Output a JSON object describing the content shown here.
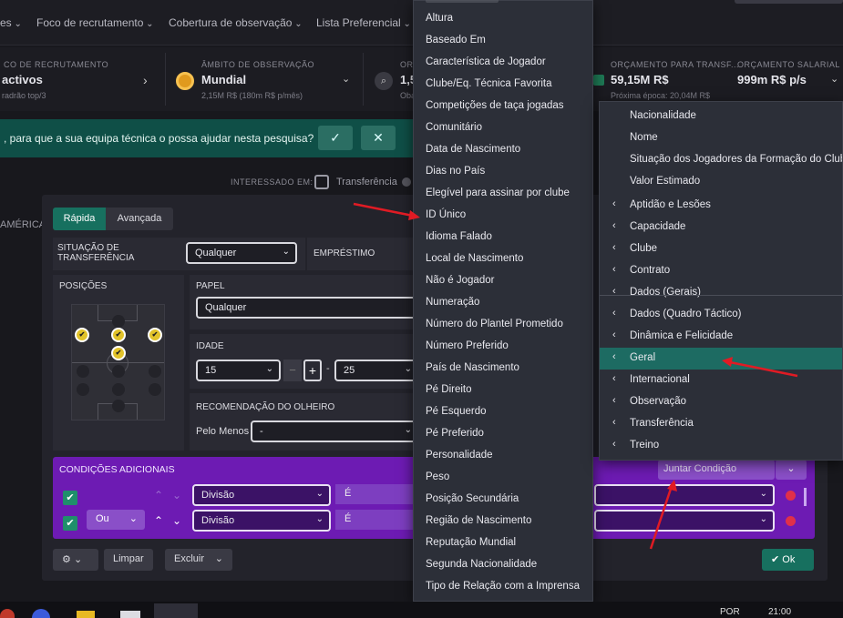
{
  "nav": {
    "items": [
      "es",
      "Foco de recrutamento",
      "Cobertura de observação",
      "Lista Preferencial"
    ]
  },
  "stats": {
    "focus": {
      "label": "CO DE RECRUTAMENTO",
      "value": "activos",
      "sub": "radrão top/3"
    },
    "scope": {
      "label": "ÂMBITO DE OBSERVAÇÃO",
      "value": "Mundial",
      "sub": "2,15M R$ (180m R$ p/mês)"
    },
    "third": {
      "label": "OR",
      "value": "1,5",
      "sub": "Oba"
    },
    "transfer_budget": {
      "label": "ORÇAMENTO PARA TRANSF...",
      "value": "59,15M R$",
      "sub": "Próxima época: 20,04M R$"
    },
    "wage_budget": {
      "label": "ORÇAMENTO SALARIAL",
      "value": "999m R$ p/s"
    }
  },
  "banner": {
    "text": ", para que a sua equipa técnica o possa ajudar nesta pesquisa?",
    "confirm": "✓",
    "dismiss": "✕"
  },
  "interest": {
    "label": "INTERESSADO EM:",
    "option": "Transferência"
  },
  "left_edge_text": "AMÉRICA",
  "dialog": {
    "tabs": [
      "Rápida",
      "Avançada"
    ],
    "transfer_status": {
      "label": "SITUAÇÃO DE TRANSFERÊNCIA",
      "value": "Qualquer"
    },
    "loan": {
      "label": "EMPRÉSTIMO"
    },
    "positions": {
      "label": "POSIÇÕES"
    },
    "role": {
      "label": "PAPEL",
      "value": "Qualquer"
    },
    "age": {
      "label": "IDADE",
      "min": "15",
      "max": "25",
      "minus": "−",
      "plus": "+",
      "dash": "-"
    },
    "scout": {
      "label": "RECOMENDAÇÃO DO OLHEIRO",
      "prefix": "Pelo Menos",
      "value": "-"
    },
    "conditions": {
      "label": "CONDIÇÕES ADICIONAIS",
      "join": "Juntar Condição",
      "rows": [
        {
          "connector": "",
          "field": "Divisão",
          "op": "É"
        },
        {
          "connector": "Ou",
          "field": "Divisão",
          "op": "É"
        }
      ]
    },
    "footer": {
      "clear": "Limpar",
      "delete": "Excluir",
      "ok": "Ok"
    }
  },
  "dropdown_main": {
    "items": [
      "Altura",
      "Baseado Em",
      "Característica de Jogador",
      "Clube/Eq. Técnica Favorita",
      "Competições de taça jogadas",
      "Comunitário",
      "Data de Nascimento",
      "Dias no País",
      "Elegível para assinar por clube",
      "ID Único",
      "Idioma Falado",
      "Local de Nascimento",
      "Não é Jogador",
      "Numeração",
      "Número do Plantel Prometido",
      "Número Preferido",
      "País de Nascimento",
      "Pé Direito",
      "Pé Esquerdo",
      "Pé Preferido",
      "Personalidade",
      "Peso",
      "Posição Secundária",
      "Região de Nascimento",
      "Reputação Mundial",
      "Segunda Nacionalidade",
      "Tipo de Relação com a Imprensa"
    ]
  },
  "dropdown_sub": {
    "plain": [
      "Nacionalidade",
      "Nome",
      "Situação dos Jogadores da Formação do Clube",
      "Valor Estimado"
    ],
    "categories": [
      "Aptidão e Lesões",
      "Capacidade",
      "Clube",
      "Contrato",
      "Dados (Gerais)",
      "Dados (Quadro Táctico)",
      "Dinâmica e Felicidade",
      "Geral",
      "Internacional",
      "Observação",
      "Transferência",
      "Treino"
    ],
    "highlighted": "Geral"
  },
  "taskbar": {
    "lang": "POR",
    "time": "21:00"
  },
  "colors": {
    "accent": "#1d6b62",
    "purple": "#6d1bb3",
    "annotation": "#e01b24",
    "ok_green": "#17705f"
  }
}
